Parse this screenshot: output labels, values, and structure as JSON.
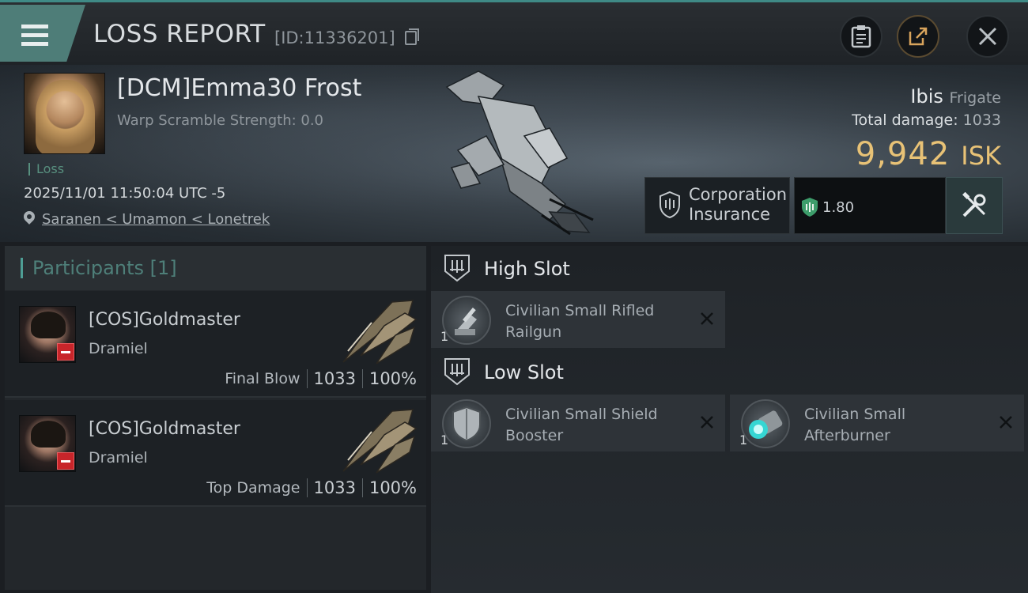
{
  "header": {
    "title": "LOSS REPORT",
    "id_text": "[ID:11336201]"
  },
  "victim": {
    "name": "[DCM]Emma30 Frost",
    "warp_scramble": "Warp Scramble Strength: 0.0",
    "status": "Loss",
    "datetime": "2025/11/01 11:50:04 UTC -5",
    "location": "Saranen < Umamon < Lonetrek",
    "ship_name": "Ibis",
    "ship_class": "Frigate",
    "total_damage_label": "Total damage:",
    "total_damage": "1033",
    "isk_value": "9,942",
    "isk_unit": "ISK",
    "insurance_label_1": "Corporation",
    "insurance_label_2": "Insurance",
    "insurance_value": "1.80"
  },
  "participants": {
    "title": "Participants [1]",
    "rows": [
      {
        "name": "[COS]Goldmaster",
        "ship": "Dramiel",
        "role": "Final Blow",
        "damage": "1033",
        "percent": "100%"
      },
      {
        "name": "[COS]Goldmaster",
        "ship": "Dramiel",
        "role": "Top Damage",
        "damage": "1033",
        "percent": "100%"
      }
    ]
  },
  "fittings": {
    "high_slot": {
      "title": "High Slot",
      "modules": [
        {
          "qty": "1",
          "name_line1": "Civilian Small Rifled",
          "name_line2": "Railgun"
        }
      ]
    },
    "low_slot": {
      "title": "Low Slot",
      "modules": [
        {
          "qty": "1",
          "name_line1": "Civilian Small Shield",
          "name_line2": "Booster"
        },
        {
          "qty": "1",
          "name_line1": "Civilian Small",
          "name_line2": "Afterburner"
        }
      ]
    }
  },
  "colors": {
    "accent_teal": "#4e7d78",
    "isk_gold": "#e8c276",
    "minus_red": "#c8252a"
  },
  "icons": [
    "menu-icon",
    "copy-icon",
    "clipboard-icon",
    "share-icon",
    "close-icon",
    "location-pin-icon",
    "shield-icon",
    "tools-icon",
    "slot-icon",
    "remove-icon"
  ]
}
